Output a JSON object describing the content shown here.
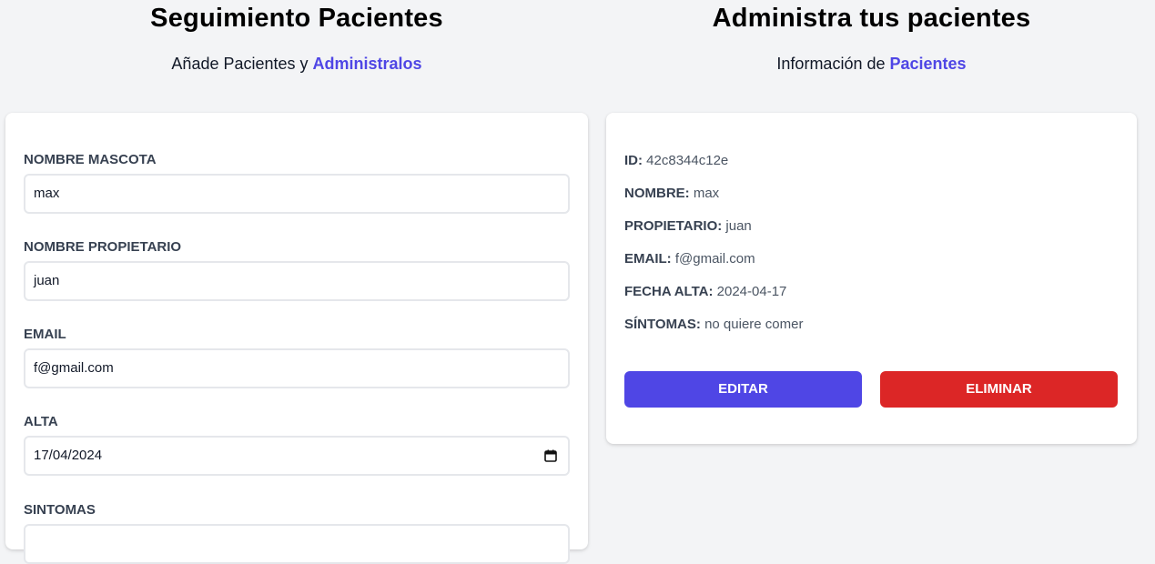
{
  "form_section": {
    "title": "Seguimiento Pacientes",
    "subtitle_text": "Añade Pacientes y ",
    "subtitle_accent": "Administralos",
    "fields": [
      {
        "label": "Nombre Mascota",
        "value": "max"
      },
      {
        "label": "Nombre Propietario",
        "value": "juan"
      },
      {
        "label": "Email",
        "value": "f@gmail.com"
      },
      {
        "label": "Alta",
        "value": "17/04/2024"
      },
      {
        "label": "Sintomas",
        "value": ""
      }
    ],
    "date_icon": "calendar-icon"
  },
  "list_section": {
    "title": "Administra tus pacientes",
    "subtitle_text": "Información de ",
    "subtitle_accent": "Pacientes",
    "patient": {
      "id_label": "ID:",
      "id_value": "42c8344c12e",
      "name_label": "Nombre:",
      "name_value": "max",
      "owner_label": "Propietario:",
      "owner_value": "juan",
      "email_label": "Email:",
      "email_value": "f@gmail.com",
      "date_label": "Fecha Alta:",
      "date_value": "2024-04-17",
      "symptoms_label": "Síntomas:",
      "symptoms_value": "no quiere comer"
    },
    "edit_label": "Editar",
    "delete_label": "Eliminar"
  },
  "colors": {
    "accent": "#4f46e5",
    "danger": "#dc2626",
    "background": "#f3f4f6"
  }
}
